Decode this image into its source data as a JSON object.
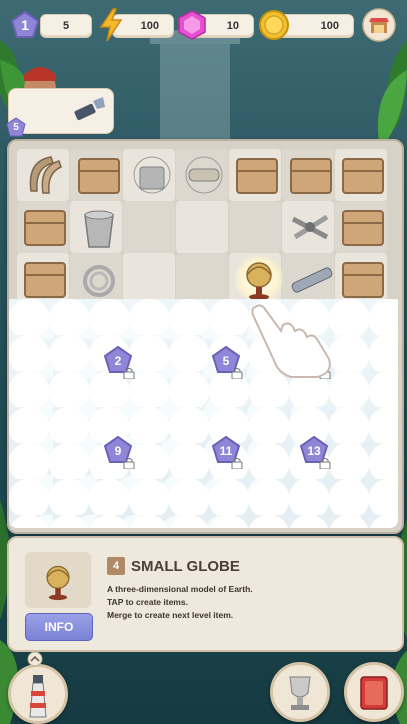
{
  "topbar": {
    "level": "1",
    "stars": "5",
    "energy": "100",
    "gems": "10",
    "coins": "100",
    "icons": [
      "level-star-icon",
      "lightning-icon",
      "gem-icon",
      "coin-icon",
      "shop-icon"
    ]
  },
  "character": {
    "level": "5",
    "icons": [
      "captain-portrait",
      "flashlight-icon"
    ]
  },
  "board": {
    "locked_cells": [
      {
        "level": "2"
      },
      {
        "level": "5"
      },
      {
        "level": "7"
      },
      {
        "level": "9"
      },
      {
        "level": "11"
      },
      {
        "level": "13"
      }
    ],
    "items": [
      "horseshoe",
      "crate",
      "cobweb",
      "compass",
      "globe",
      "spyglass",
      "bucket",
      "rope-coil",
      "pipes"
    ]
  },
  "info_panel": {
    "level": "4",
    "title": "SMALL GLOBE",
    "desc_lines": [
      "A three-dimensional model of Earth.",
      "TAP to create items.",
      "Merge to create next level item."
    ],
    "button_label": "INFO"
  },
  "bottom": {
    "icons": [
      "lighthouse-icon",
      "trophy-icon",
      "book-icon"
    ]
  },
  "colors": {
    "accent": "#7b82d6",
    "gem": "#e84fd1",
    "coin": "#f2c02f"
  }
}
